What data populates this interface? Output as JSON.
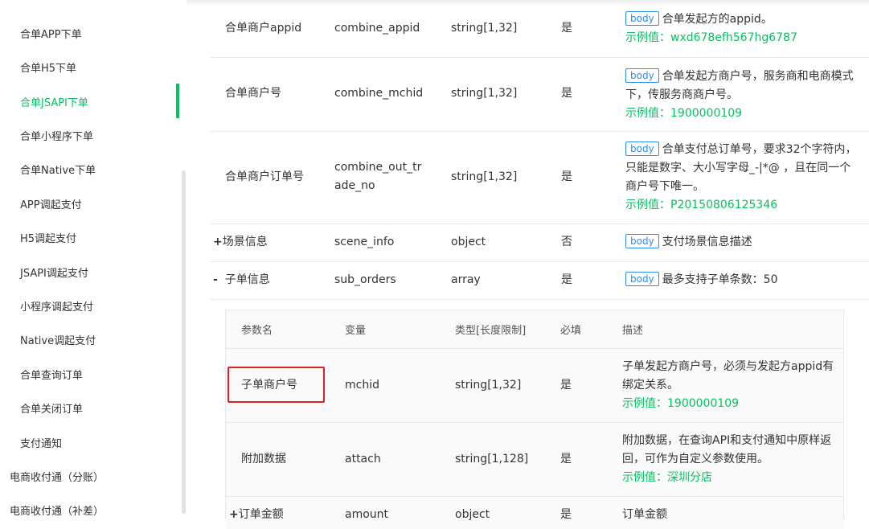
{
  "sidebar": {
    "items": [
      {
        "label": "合单APP下单",
        "active": false
      },
      {
        "label": "合单H5下单",
        "active": false
      },
      {
        "label": "合单JSAPI下单",
        "active": true
      },
      {
        "label": "合单小程序下单",
        "active": false
      },
      {
        "label": "合单Native下单",
        "active": false
      },
      {
        "label": "APP调起支付",
        "active": false
      },
      {
        "label": "H5调起支付",
        "active": false
      },
      {
        "label": "JSAPI调起支付",
        "active": false
      },
      {
        "label": "小程序调起支付",
        "active": false
      },
      {
        "label": "Native调起支付",
        "active": false
      },
      {
        "label": "合单查询订单",
        "active": false
      },
      {
        "label": "合单关闭订单",
        "active": false
      },
      {
        "label": "支付通知",
        "active": false
      }
    ],
    "groups": [
      {
        "label": "电商收付通（分账）"
      },
      {
        "label": "电商收付通（补差）"
      }
    ]
  },
  "params": {
    "tag": "body",
    "example_prefix": "示例值：",
    "rows": [
      {
        "name": "合单商户appid",
        "var": "combine_appid",
        "type": "string[1,32]",
        "required": "是",
        "desc": "合单发起方的appid。",
        "example": "wxd678efh567hg6787"
      },
      {
        "name": "合单商户号",
        "var": "combine_mchid",
        "type": "string[1,32]",
        "required": "是",
        "desc": "合单发起方商户号，服务商和电商模式下，传服务商商户号。",
        "example": "1900000109"
      },
      {
        "name": "合单商户订单号",
        "var1": "combine_out_tr",
        "var2": "ade_no",
        "type": "string[1,32]",
        "required": "是",
        "desc": "合单支付总订单号，要求32个字符内，只能是数字、大小写字母_-|*@ ，且在同一个商户号下唯一。",
        "example": "P20150806125346"
      },
      {
        "expander": "+",
        "name": "场景信息",
        "var": "scene_info",
        "type": "object",
        "required": "否",
        "desc": "支付场景信息描述"
      },
      {
        "expander": "-",
        "name": "子单信息",
        "var": "sub_orders",
        "type": "array",
        "required": "是",
        "desc": "最多支持子单条数：50"
      }
    ]
  },
  "sub_table": {
    "headers": {
      "name": "参数名",
      "var": "变量",
      "type": "类型[长度限制]",
      "required": "必填",
      "desc": "描述"
    },
    "rows": [
      {
        "name": "子单商户号",
        "var": "mchid",
        "type": "string[1,32]",
        "required": "是",
        "desc": "子单发起方商户号，必须与发起方appid有绑定关系。",
        "example_prefix": "示例值：",
        "example": "1900000109"
      },
      {
        "name": "附加数据",
        "var": "attach",
        "type": "string[1,128]",
        "required": "是",
        "desc": "附加数据，在查询API和支付通知中原样返回，可作为自定义参数使用。",
        "example_prefix": "示例值：",
        "example": "深圳分店"
      },
      {
        "expander": "+",
        "name": "订单金额",
        "var": "amount",
        "type": "object",
        "required": "是",
        "desc": "订单金额"
      }
    ]
  },
  "colors": {
    "accent": "#07c160",
    "tag": "#2d8cf0",
    "highlight": "#e02020"
  }
}
